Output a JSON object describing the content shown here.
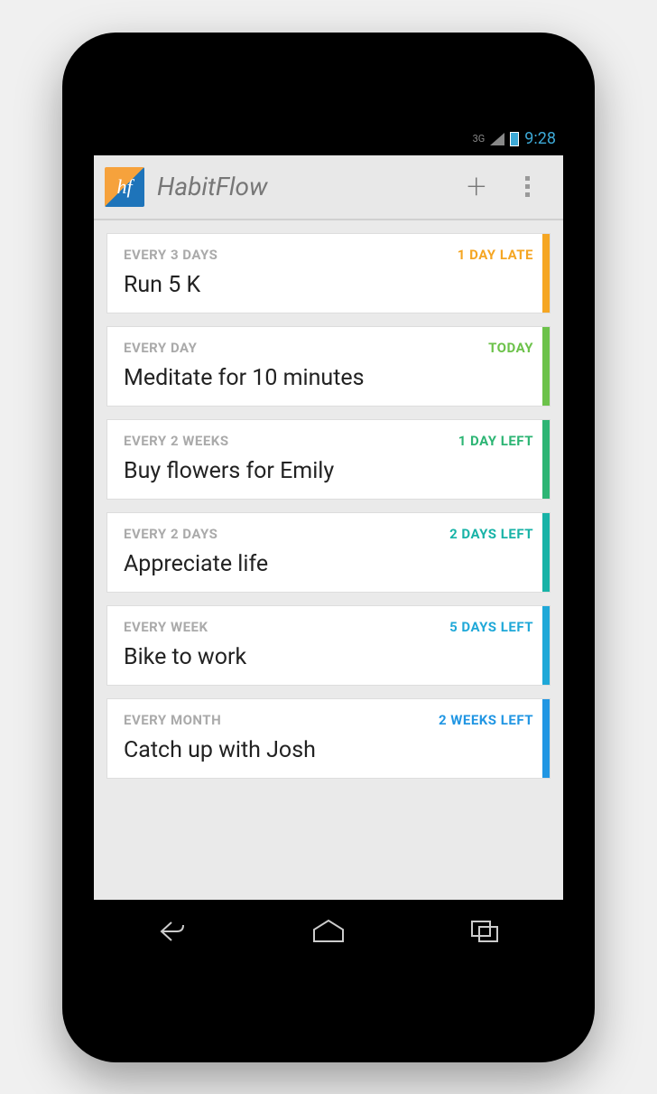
{
  "status_bar": {
    "network": "3G",
    "time": "9:28"
  },
  "action_bar": {
    "logo_text": "hf",
    "title": "HabitFlow"
  },
  "colors": {
    "late": "#f5a623",
    "today": "#6cc24a",
    "soon_green": "#2db574",
    "teal": "#18b3a7",
    "blue": "#1fa8d8",
    "blue2": "#2196e3"
  },
  "habits": [
    {
      "frequency": "EVERY 3 DAYS",
      "status": "1 DAY LATE",
      "title": "Run 5 K",
      "status_color": "#f5a623",
      "stripe_color": "#f5a623"
    },
    {
      "frequency": "EVERY DAY",
      "status": "TODAY",
      "title": "Meditate for 10 minutes",
      "status_color": "#6cc24a",
      "stripe_color": "#6cc24a"
    },
    {
      "frequency": "EVERY 2 WEEKS",
      "status": "1 DAY LEFT",
      "title": "Buy flowers for Emily",
      "status_color": "#2db574",
      "stripe_color": "#2db574"
    },
    {
      "frequency": "EVERY 2 DAYS",
      "status": "2 DAYS LEFT",
      "title": "Appreciate life",
      "status_color": "#18b3a7",
      "stripe_color": "#18b3a7"
    },
    {
      "frequency": "EVERY WEEK",
      "status": "5 DAYS LEFT",
      "title": "Bike to work",
      "status_color": "#1fa8d8",
      "stripe_color": "#1fa8d8"
    },
    {
      "frequency": "EVERY MONTH",
      "status": "2 WEEKS LEFT",
      "title": "Catch up with Josh",
      "status_color": "#2196e3",
      "stripe_color": "#2196e3"
    }
  ]
}
